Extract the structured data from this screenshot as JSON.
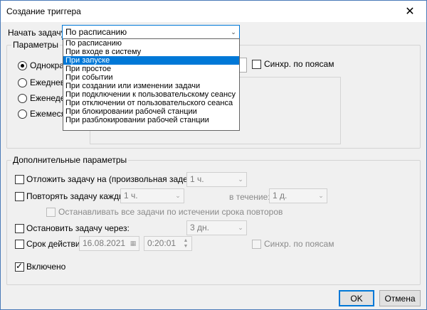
{
  "window": {
    "title": "Создание триггера",
    "close": "✕"
  },
  "start_task": {
    "label": "Начать задачу:",
    "value": "По расписанию",
    "options": [
      "По расписанию",
      "При входе в систему",
      "При запуске",
      "При простое",
      "При событии",
      "При создании или изменении задачи",
      "При подключении к пользовательскому сеансу",
      "При отключении от пользовательского сеанса",
      "При блокировании рабочей станции",
      "При разблокировании рабочей станции"
    ],
    "selected_index": 2
  },
  "parameters": {
    "legend": "Параметры",
    "radios": [
      "Однократ",
      "Ежедневно",
      "Еженедель",
      "Ежемесяч"
    ],
    "checked_radio": 0,
    "sync_label": "Синхр. по поясам"
  },
  "advanced": {
    "legend": "Дополнительные параметры",
    "delay_label": "Отложить задачу на (произвольная задержка):",
    "delay_value": "1 ч.",
    "repeat_label": "Повторять задачу каждые:",
    "repeat_value": "1 ч.",
    "duration_label": "в течение:",
    "duration_value": "1 д.",
    "stop_all_label": "Останавливать все задачи по истечении срока повторов",
    "stop_after_label": "Остановить задачу через:",
    "stop_after_value": "3 дн.",
    "expire_label": "Срок действия:",
    "expire_date": "16.08.2021",
    "expire_time": "0:20:01",
    "sync_label": "Синхр. по поясам",
    "enabled_label": "Включено"
  },
  "buttons": {
    "ok": "OK",
    "cancel": "Отмена"
  }
}
